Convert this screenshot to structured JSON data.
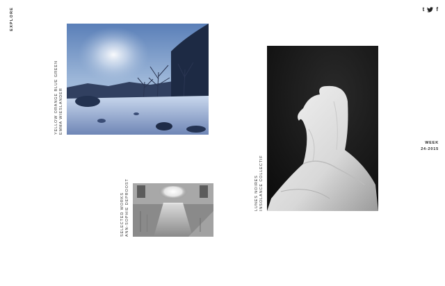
{
  "nav": {
    "explore_label": "EXPLORE"
  },
  "social": {
    "tumblr": "t",
    "twitter": "twitter-icon",
    "facebook": "f"
  },
  "week": {
    "label": "WEEK",
    "number": "24-2015"
  },
  "cards": [
    {
      "title": "YELLOW ORANGE BLUE GREEN",
      "author": "EMMA WIESLANDER"
    },
    {
      "title": "SELECTED WORKS",
      "author": "ANN-SOPHIE DEPROOST"
    },
    {
      "title": "LUNES NOIRES",
      "author": "INSOLANCE COLLECTIF"
    }
  ]
}
